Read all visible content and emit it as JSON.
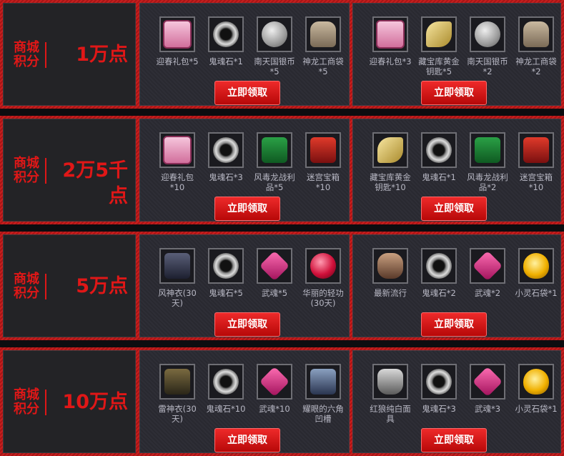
{
  "tiers": [
    {
      "caption": "商城积分",
      "amount": "1万点",
      "panels": [
        {
          "items": [
            {
              "name": "迎春礼包*5",
              "icon": "pink-gift-box-icon"
            },
            {
              "name": "鬼魂石*1",
              "icon": "ghost-stone-icon"
            },
            {
              "name": "南天国银币*5",
              "icon": "silver-coin-icon"
            },
            {
              "name": "神龙工商袋*5",
              "icon": "cloth-bag-icon"
            }
          ],
          "button": "立即领取"
        },
        {
          "items": [
            {
              "name": "迎春礼包*3",
              "icon": "pink-gift-box-icon"
            },
            {
              "name": "藏宝库黄金钥匙*5",
              "icon": "golden-key-icon"
            },
            {
              "name": "南天国银币*2",
              "icon": "silver-coin-icon"
            },
            {
              "name": "神龙工商袋*2",
              "icon": "cloth-bag-icon"
            }
          ],
          "button": "立即领取"
        }
      ]
    },
    {
      "caption": "商城积分",
      "amount": "2万5千点",
      "panels": [
        {
          "items": [
            {
              "name": "迎春礼包*10",
              "icon": "pink-gift-box-icon"
            },
            {
              "name": "鬼魂石*3",
              "icon": "ghost-stone-icon"
            },
            {
              "name": "风毒龙战利品*5",
              "icon": "green-chest-icon"
            },
            {
              "name": "迷宫宝箱*10",
              "icon": "red-gift-icon"
            }
          ],
          "button": "立即领取"
        },
        {
          "items": [
            {
              "name": "藏宝库黄金钥匙*10",
              "icon": "golden-key-icon"
            },
            {
              "name": "鬼魂石*1",
              "icon": "ghost-stone-icon"
            },
            {
              "name": "风毒龙战利品*2",
              "icon": "green-chest-icon"
            },
            {
              "name": "迷宫宝箱*10",
              "icon": "red-gift-icon"
            }
          ],
          "button": "立即领取"
        }
      ]
    },
    {
      "caption": "商城积分",
      "amount": "5万点",
      "panels": [
        {
          "items": [
            {
              "name": "风神衣(30天)",
              "icon": "dark-armor-icon"
            },
            {
              "name": "鬼魂石*5",
              "icon": "ghost-stone-icon"
            },
            {
              "name": "武魂*5",
              "icon": "pink-gem-icon"
            },
            {
              "name": "华丽的轻功(30天)",
              "icon": "ruby-orb-icon"
            }
          ],
          "button": "立即领取"
        },
        {
          "items": [
            {
              "name": "最新流行",
              "icon": "sunglasses-icon"
            },
            {
              "name": "鬼魂石*2",
              "icon": "ghost-stone-icon"
            },
            {
              "name": "武魂*2",
              "icon": "pink-gem-icon"
            },
            {
              "name": "小灵石袋*1",
              "icon": "gold-bag-icon"
            }
          ],
          "button": "立即领取"
        }
      ]
    },
    {
      "caption": "商城积分",
      "amount": "10万点",
      "panels": [
        {
          "items": [
            {
              "name": "雷神衣(30天)",
              "icon": "gold-armor-icon"
            },
            {
              "name": "鬼魂石*10",
              "icon": "ghost-stone-icon"
            },
            {
              "name": "武魂*10",
              "icon": "pink-gem-icon"
            },
            {
              "name": "耀眼的六角凹槽",
              "icon": "hammer-icon"
            }
          ],
          "button": "立即领取"
        },
        {
          "items": [
            {
              "name": "红狼纯白面具",
              "icon": "mask-icon"
            },
            {
              "name": "鬼魂石*3",
              "icon": "ghost-stone-icon"
            },
            {
              "name": "武魂*3",
              "icon": "pink-gem-icon"
            },
            {
              "name": "小灵石袋*1",
              "icon": "gold-bag-icon"
            }
          ],
          "button": "立即领取"
        }
      ]
    }
  ]
}
